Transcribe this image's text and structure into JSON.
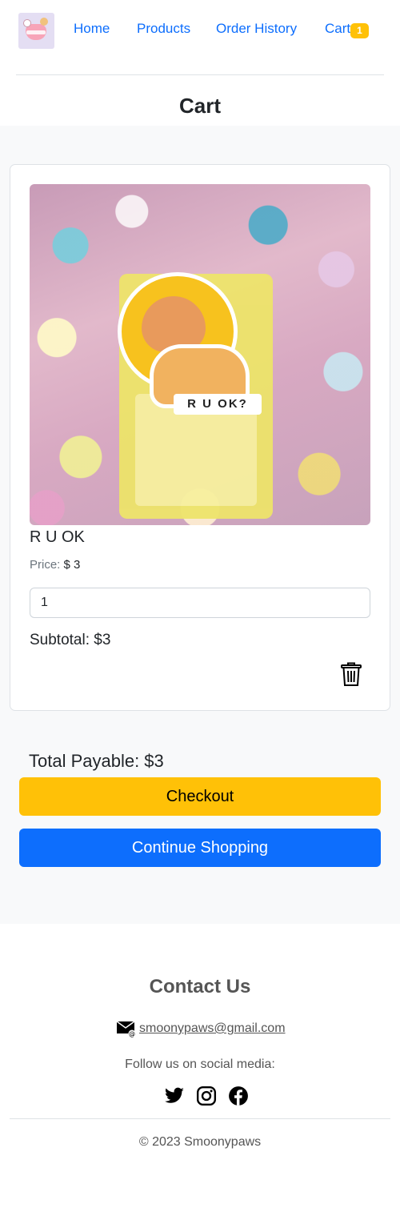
{
  "nav": {
    "home": "Home",
    "products": "Products",
    "order_history": "Order History",
    "cart": "Cart",
    "cart_count": "1"
  },
  "page": {
    "title": "Cart"
  },
  "cart_item": {
    "name": "R U OK",
    "price_label": "Price:",
    "price_value": "$ 3",
    "quantity": "1",
    "subtotal": "Subtotal: $3",
    "sticker_text": "R U OK?",
    "delete_icon": "trash-icon"
  },
  "summary": {
    "total": "Total Payable: $3",
    "checkout_label": "Checkout",
    "continue_label": "Continue Shopping"
  },
  "footer": {
    "title": "Contact Us",
    "email": "smoonypaws@gmail.com",
    "follow": "Follow us on social media:",
    "social_icons": [
      "twitter-icon",
      "instagram-icon",
      "facebook-icon"
    ],
    "copyright": "© 2023 Smoonypaws"
  },
  "colors": {
    "link": "#0d6efd",
    "checkout": "#ffc107",
    "continue": "#0d6efd",
    "section_bg": "#f8f9fa"
  }
}
